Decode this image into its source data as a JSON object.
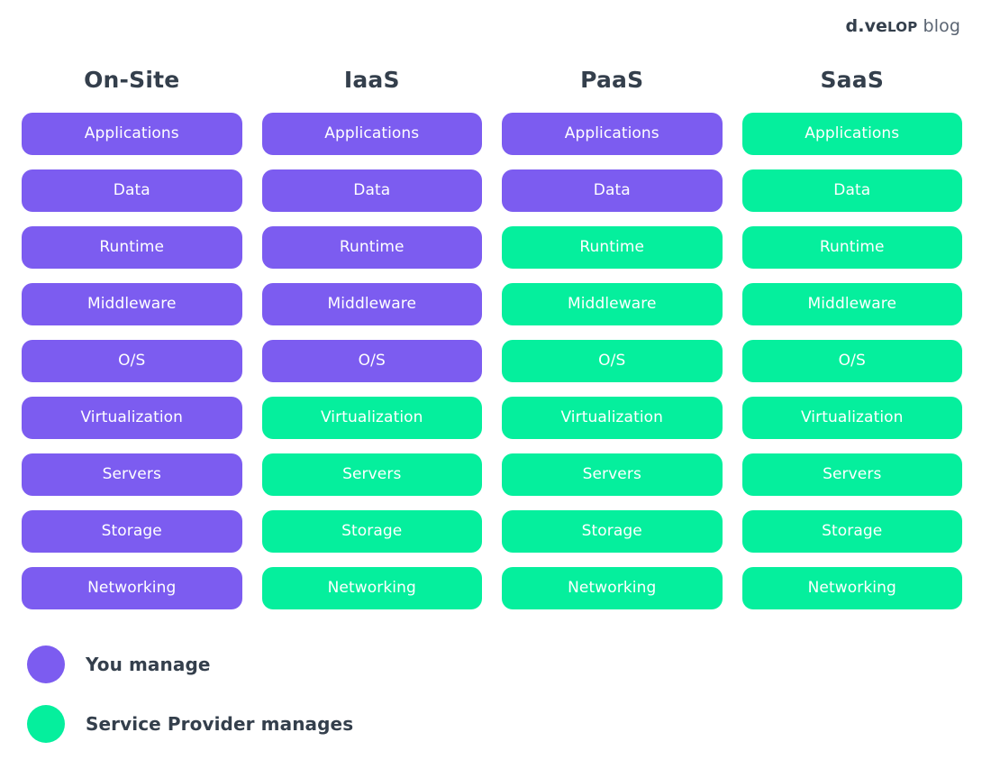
{
  "brand": {
    "part1": "d.ve",
    "part2": "Lop",
    "part3": " blog"
  },
  "colors": {
    "you_manage": "#7c5cf0",
    "provider_manages": "#05ef9d",
    "heading": "#343f4c",
    "pill_text": "#ffffff",
    "background": "#ffffff"
  },
  "rows": [
    "Applications",
    "Data",
    "Runtime",
    "Middleware",
    "O/S",
    "Virtualization",
    "Servers",
    "Storage",
    "Networking"
  ],
  "columns": [
    {
      "header": "On-Site",
      "cells": [
        {
          "label": "Applications",
          "owner": "you"
        },
        {
          "label": "Data",
          "owner": "you"
        },
        {
          "label": "Runtime",
          "owner": "you"
        },
        {
          "label": "Middleware",
          "owner": "you"
        },
        {
          "label": "O/S",
          "owner": "you"
        },
        {
          "label": "Virtualization",
          "owner": "you"
        },
        {
          "label": "Servers",
          "owner": "you"
        },
        {
          "label": "Storage",
          "owner": "you"
        },
        {
          "label": "Networking",
          "owner": "you"
        }
      ]
    },
    {
      "header": "IaaS",
      "cells": [
        {
          "label": "Applications",
          "owner": "you"
        },
        {
          "label": "Data",
          "owner": "you"
        },
        {
          "label": "Runtime",
          "owner": "you"
        },
        {
          "label": "Middleware",
          "owner": "you"
        },
        {
          "label": "O/S",
          "owner": "you"
        },
        {
          "label": "Virtualization",
          "owner": "provider"
        },
        {
          "label": "Servers",
          "owner": "provider"
        },
        {
          "label": "Storage",
          "owner": "provider"
        },
        {
          "label": "Networking",
          "owner": "provider"
        }
      ]
    },
    {
      "header": "PaaS",
      "cells": [
        {
          "label": "Applications",
          "owner": "you"
        },
        {
          "label": "Data",
          "owner": "you"
        },
        {
          "label": "Runtime",
          "owner": "provider"
        },
        {
          "label": "Middleware",
          "owner": "provider"
        },
        {
          "label": "O/S",
          "owner": "provider"
        },
        {
          "label": "Virtualization",
          "owner": "provider"
        },
        {
          "label": "Servers",
          "owner": "provider"
        },
        {
          "label": "Storage",
          "owner": "provider"
        },
        {
          "label": "Networking",
          "owner": "provider"
        }
      ]
    },
    {
      "header": "SaaS",
      "cells": [
        {
          "label": "Applications",
          "owner": "provider"
        },
        {
          "label": "Data",
          "owner": "provider"
        },
        {
          "label": "Runtime",
          "owner": "provider"
        },
        {
          "label": "Middleware",
          "owner": "provider"
        },
        {
          "label": "O/S",
          "owner": "provider"
        },
        {
          "label": "Virtualization",
          "owner": "provider"
        },
        {
          "label": "Servers",
          "owner": "provider"
        },
        {
          "label": "Storage",
          "owner": "provider"
        },
        {
          "label": "Networking",
          "owner": "provider"
        }
      ]
    }
  ],
  "legend": [
    {
      "key": "you",
      "label": "You manage"
    },
    {
      "key": "provider",
      "label": "Service Provider manages"
    }
  ]
}
